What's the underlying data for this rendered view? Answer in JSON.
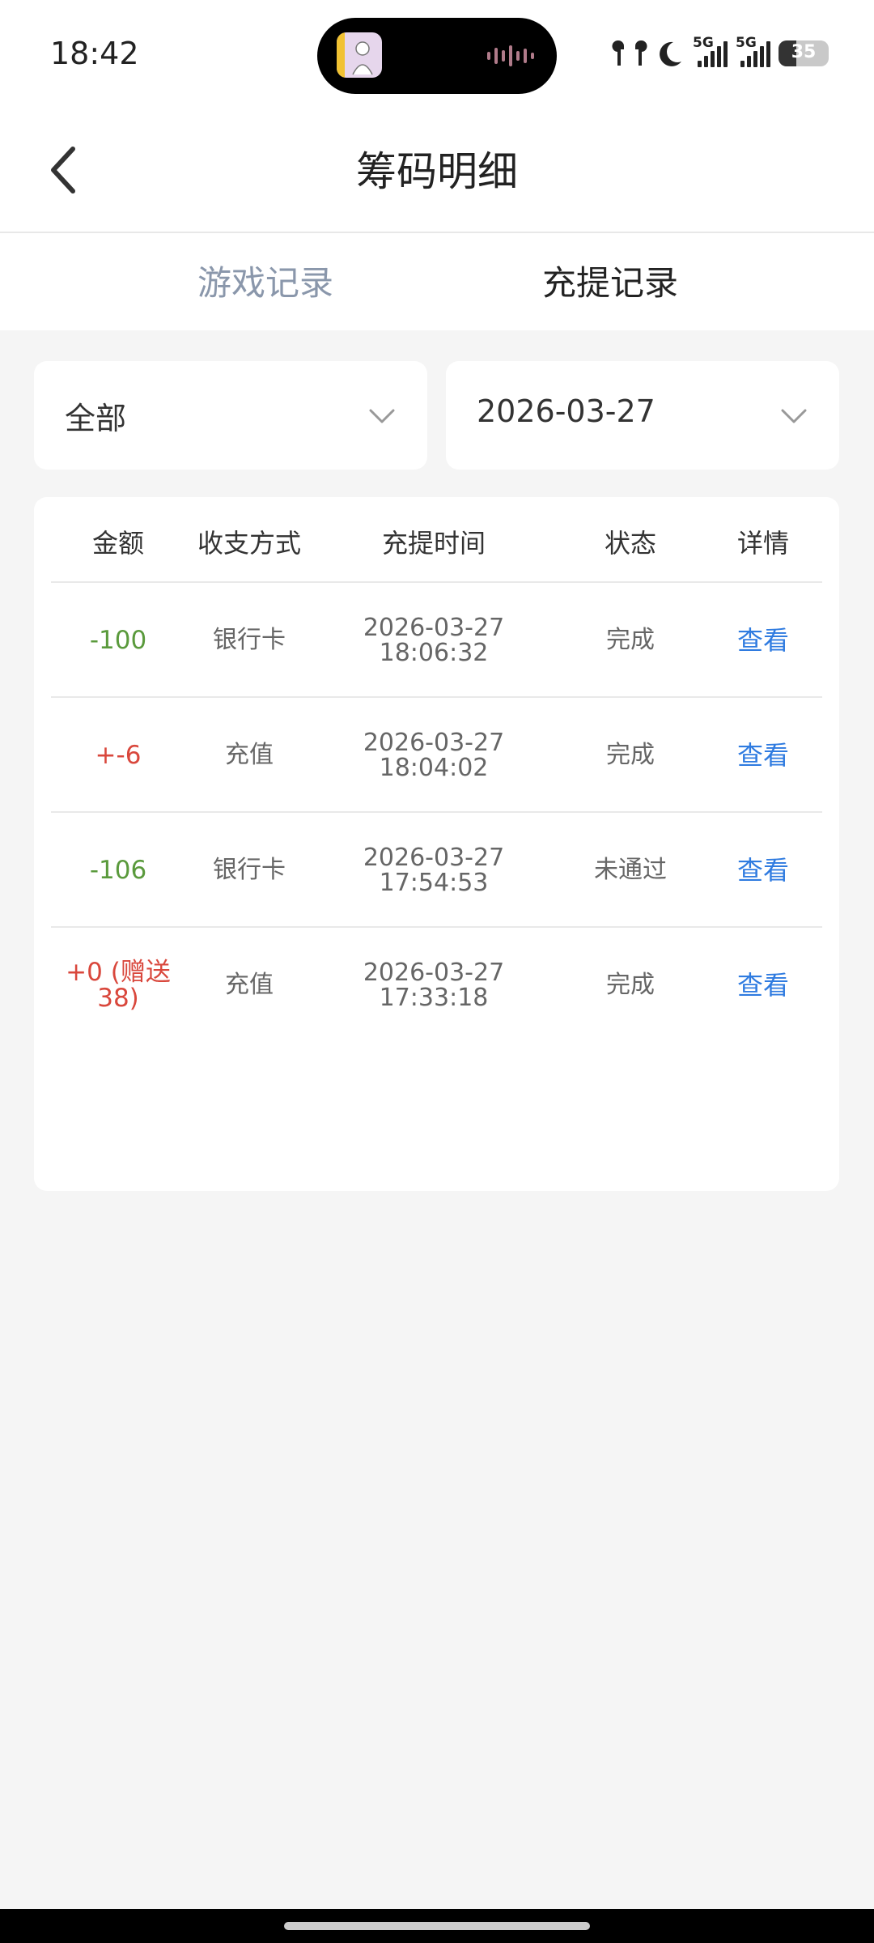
{
  "status_bar": {
    "time": "18:42",
    "network_label_1": "5G",
    "network_label_2": "5G",
    "battery_level": "35",
    "icons": [
      "earbuds-icon",
      "moon-icon",
      "signal-icon",
      "signal-icon",
      "battery-icon"
    ]
  },
  "header": {
    "title": "筹码明细",
    "back_icon": "chevron-left-icon"
  },
  "tabs": [
    {
      "label": "游戏记录",
      "active": false
    },
    {
      "label": "充提记录",
      "active": true
    }
  ],
  "filters": {
    "type": {
      "selected": "全部",
      "icon": "chevron-down-icon"
    },
    "date": {
      "selected": "2026-03-27",
      "icon": "chevron-down-icon"
    }
  },
  "table": {
    "headers": [
      "金额",
      "收支方式",
      "充提时间",
      "状态",
      "详情"
    ],
    "rows": [
      {
        "amount": "-100",
        "sign": "neg",
        "method": "银行卡",
        "date": "2026-03-27",
        "time": "18:06:32",
        "status": "完成",
        "detail": "查看"
      },
      {
        "amount": "+-6",
        "sign": "pos",
        "method": "充值",
        "date": "2026-03-27",
        "time": "18:04:02",
        "status": "完成",
        "detail": "查看"
      },
      {
        "amount": "-106",
        "sign": "neg",
        "method": "银行卡",
        "date": "2026-03-27",
        "time": "17:54:53",
        "status": "未通过",
        "detail": "查看"
      },
      {
        "amount": "+0 (赠送38)",
        "sign": "pos",
        "method": "充值",
        "date": "2026-03-27",
        "time": "17:33:18",
        "status": "完成",
        "detail": "查看"
      }
    ]
  },
  "colors": {
    "negative": "#5a9a3c",
    "positive": "#d9473c",
    "link": "#2f7be0",
    "inactive_tab": "#8a97ab"
  }
}
